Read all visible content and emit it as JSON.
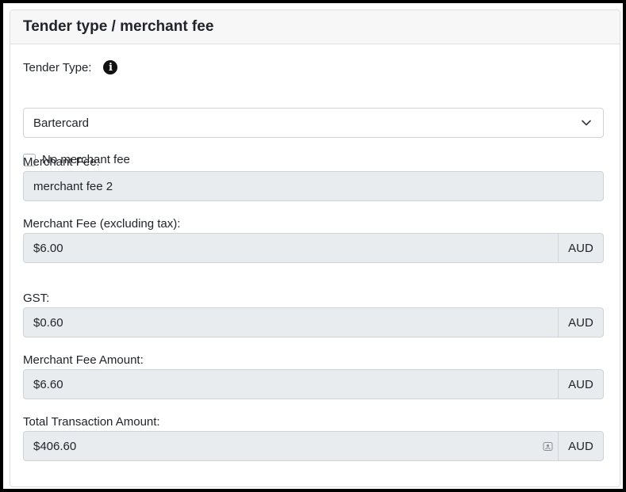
{
  "card": {
    "title": "Tender type / merchant fee"
  },
  "tender_type": {
    "label": "Tender Type:",
    "selected": "Bartercard",
    "info_icon": "info-circle-icon"
  },
  "no_fee": {
    "label": "No merchant fee",
    "checked": false
  },
  "merchant_fee": {
    "label": "Merchant Fee:",
    "value": "merchant fee 2"
  },
  "fee_ex_tax": {
    "label": "Merchant Fee (excluding tax):",
    "value": "$6.00",
    "currency": "AUD"
  },
  "gst": {
    "label": "GST:",
    "value": "$0.60",
    "currency": "AUD"
  },
  "fee_amount": {
    "label": "Merchant Fee Amount:",
    "value": "$6.60",
    "currency": "AUD"
  },
  "total": {
    "label": "Total Transaction Amount:",
    "value": "$406.60",
    "currency": "AUD"
  }
}
